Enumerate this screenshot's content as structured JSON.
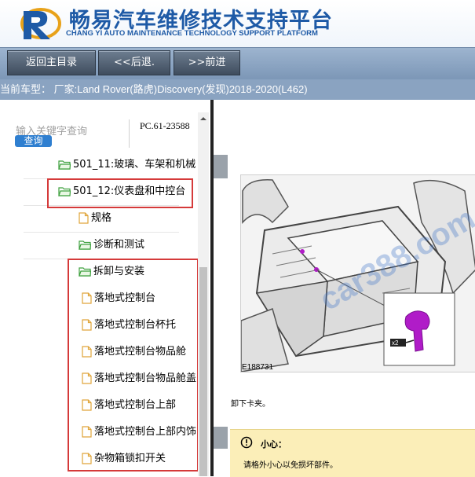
{
  "header": {
    "title_cn": "畅易汽车维修技术支持平台",
    "title_en": "CHANG YI AUTO MAINTENANCE TECHNOLOGY SUPPORT PLATFORM"
  },
  "toolbar": {
    "home_label": "返回主目录",
    "back_label": "<<后退.",
    "forward_label": ">>前进"
  },
  "model_bar": {
    "text": "当前车型： 厂家:Land Rover(路虎)Discovery(发现)2018-2020(L462)"
  },
  "search": {
    "placeholder": "输入关键字查询",
    "button_label": "查询",
    "pc_code": "PC.61-23588"
  },
  "tree": [
    {
      "label": "501_11:玻璃、车架和机械",
      "type": "folder"
    },
    {
      "label": "501_12:仪表盘和中控台",
      "type": "folder"
    },
    {
      "label": "规格",
      "type": "doc"
    },
    {
      "label": "诊断和测试",
      "type": "folder"
    },
    {
      "label": "拆卸与安装",
      "type": "folder"
    },
    {
      "label": "落地式控制台",
      "type": "doc"
    },
    {
      "label": "落地式控制台杯托",
      "type": "doc"
    },
    {
      "label": "落地式控制台物品舱",
      "type": "doc"
    },
    {
      "label": "落地式控制台物品舱盖",
      "type": "doc"
    },
    {
      "label": "落地式控制台上部",
      "type": "doc"
    },
    {
      "label": "落地式控制台上部内饰",
      "type": "doc"
    },
    {
      "label": "杂物箱锁扣开关",
      "type": "doc"
    }
  ],
  "content": {
    "figure_id": "E188731",
    "figure_badge": "x2",
    "caption": "卸下卡夹。",
    "caution_title": "小心：",
    "caution_text": "请格外小心以免损坏部件。"
  },
  "watermark": {
    "text": "car388.com"
  },
  "colors": {
    "brand_blue": "#1e5aa6",
    "toolbar_bg": "#8aa3c1",
    "highlight_red": "#d53a3a",
    "caution_bg": "#fbeeb8",
    "clip_purple": "#b01cc8"
  }
}
